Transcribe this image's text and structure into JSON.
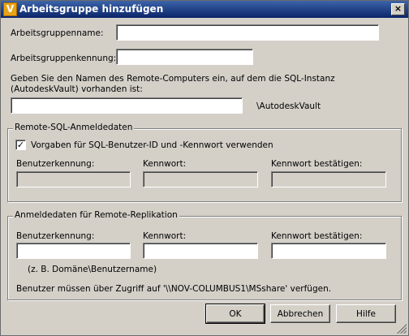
{
  "window": {
    "title": "Arbeitsgruppe hinzufügen",
    "app_icon_letter": "V",
    "close_glyph": "×"
  },
  "form": {
    "name_label": "Arbeitsgruppenname:",
    "name_value": "",
    "id_label": "Arbeitsgruppenkennung:",
    "id_value": "",
    "remote_info": "Geben Sie den Namen des Remote-Computers ein, auf dem die SQL-Instanz (AutodeskVault) vorhanden ist:",
    "remote_value": "",
    "instance_suffix": "\\AutodeskVault"
  },
  "sql_group": {
    "title": "Remote-SQL-Anmeldedaten",
    "checkbox_label": "Vorgaben für SQL-Benutzer-ID und -Kennwort verwenden",
    "checkbox_checked": true,
    "check_glyph": "✓",
    "user_label": "Benutzerkennung:",
    "password_label": "Kennwort:",
    "confirm_label": "Kennwort bestätigen:"
  },
  "replication_group": {
    "title": "Anmeldedaten für Remote-Replikation",
    "user_label": "Benutzerkennung:",
    "password_label": "Kennwort:",
    "confirm_label": "Kennwort bestätigen:",
    "hint": "(z. B. Domäne\\Benutzername)",
    "access_note": "Benutzer müssen über Zugriff auf '\\\\NOV-COLUMBUS1\\MSshare' verfügen."
  },
  "buttons": {
    "ok": "OK",
    "cancel": "Abbrechen",
    "help": "Hilfe"
  },
  "colors": {
    "title_bar": "#0a246a",
    "dialog_bg": "#d4d0c8",
    "field_bg": "#ffffff"
  }
}
